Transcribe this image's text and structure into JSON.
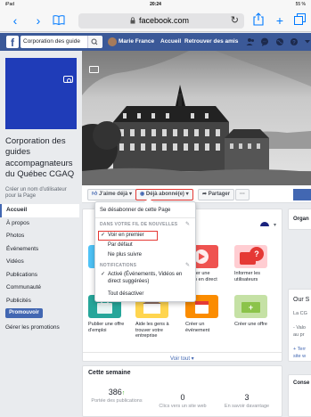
{
  "status_bar": {
    "device": "iPad",
    "wifi": "◆",
    "time": "20:24",
    "battery": "55 %"
  },
  "browser": {
    "url": "facebook.com",
    "reload_icon": "reload-icon"
  },
  "fb_header": {
    "search_value": "Corporation des guide",
    "user_name": "Marie France",
    "home": "Accueil",
    "find_friends": "Retrouver des amis"
  },
  "page": {
    "name": "Corporation des guides accompagnateurs du Québec CGAQ",
    "create_username": "Créer un nom d’utilisateur pour la Page"
  },
  "sidebar": {
    "items": [
      {
        "label": "Accueil"
      },
      {
        "label": "À propos"
      },
      {
        "label": "Photos"
      },
      {
        "label": "Événements"
      },
      {
        "label": "Vidéos"
      },
      {
        "label": "Publications"
      },
      {
        "label": "Communauté"
      },
      {
        "label": "Publicités"
      }
    ],
    "promote": "Promouvoir",
    "manage_promos": "Gérer les promotions"
  },
  "actions": {
    "like": "J’aime déjà",
    "following": "Déjà abonné(e)",
    "share": "Partager",
    "more": "···"
  },
  "follow_menu": {
    "unfollow": "Se désabonner de cette Page",
    "news_feed_header": "DANS VOTRE FIL DE NOUVELLES",
    "see_first": "Voir en premier",
    "default": "Par défaut",
    "unfollow_feed": "Ne plus suivre",
    "notifications_header": "NOTIFICATIONS",
    "enabled_line1": "Activé (Événements, Vidéos en",
    "enabled_line2": "direct suggérées)",
    "disable_all": "Tout désactiver"
  },
  "tiles": {
    "row1": [
      {
        "label": "",
        "color": "#4fc3f7"
      },
      {
        "label": "",
        "color": "#ffffff"
      },
      {
        "label": "Lancer une vidéo en direct",
        "color": "#ef5350"
      },
      {
        "label": "Informer les utilisateurs",
        "color": "#e53935"
      }
    ],
    "row2": [
      {
        "label": "Publier une offre d’emploi",
        "color": "#26a69a"
      },
      {
        "label": "Aide les gens à trouver votre entreprise",
        "color": "#ffd54f"
      },
      {
        "label": "Créer un événement",
        "color": "#fb8c00"
      },
      {
        "label": "Créer une offre",
        "color": "#8bc34a"
      }
    ],
    "see_all": "Voir tout ▾"
  },
  "week": {
    "title": "Cette semaine",
    "stats": [
      {
        "num": "386",
        "label": "Portée des publications"
      },
      {
        "num": "0",
        "label": "Clics vers un site web"
      },
      {
        "num": "3",
        "label": "En savoir davantage"
      }
    ]
  },
  "right_col": {
    "org": "Organ",
    "our": "Our S",
    "lacg": "La CG",
    "valu": "- Valo",
    "au": "au pr",
    "terr": "+ Terr",
    "site": "site w",
    "conse": "Conse"
  }
}
